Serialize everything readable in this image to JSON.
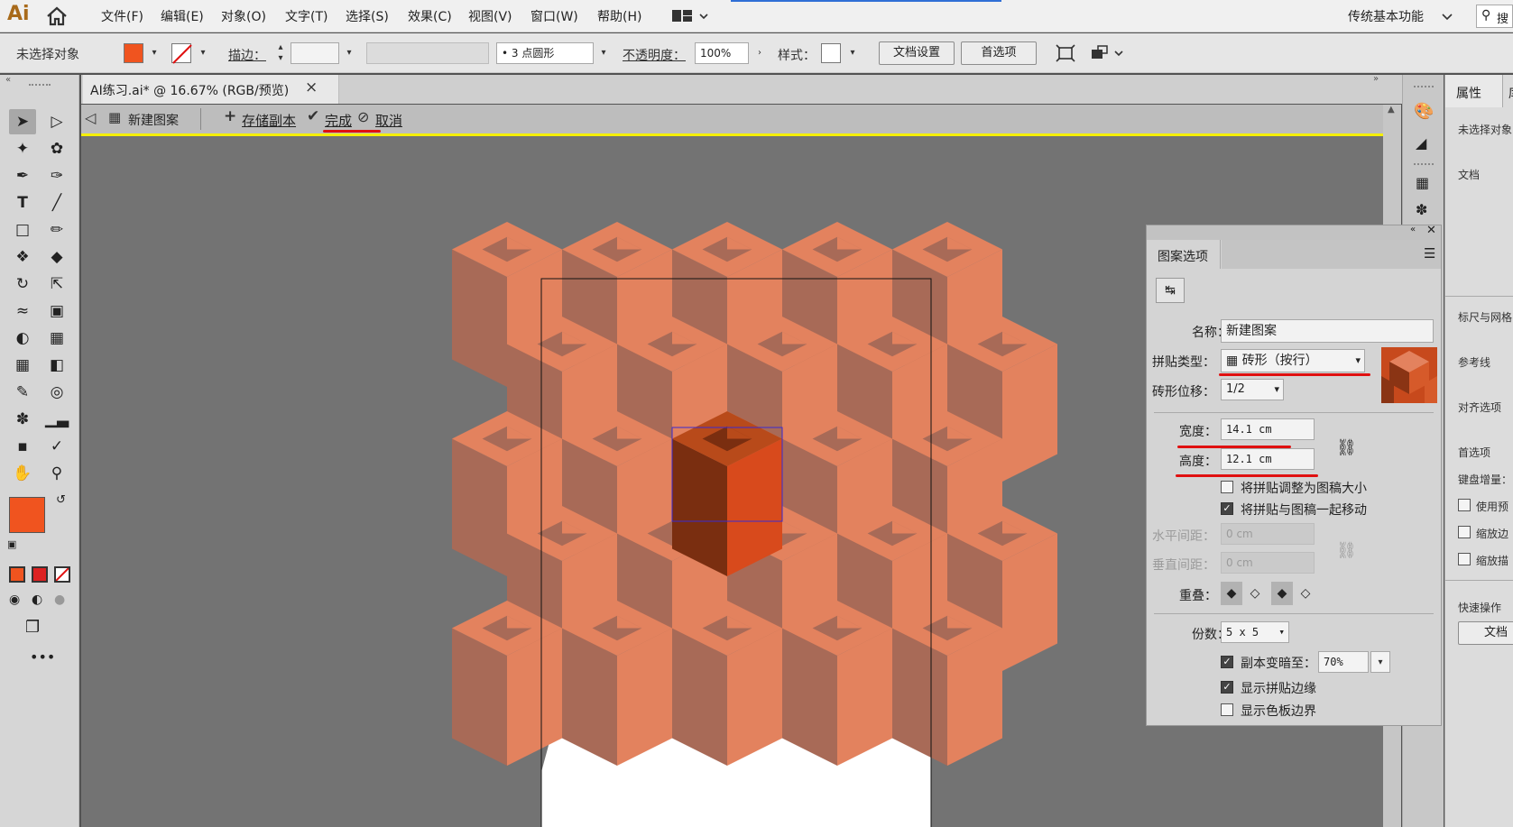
{
  "app": {
    "logo": "Ai"
  },
  "menu": [
    "文件(F)",
    "编辑(E)",
    "对象(O)",
    "文字(T)",
    "选择(S)",
    "效果(C)",
    "视图(V)",
    "窗口(W)",
    "帮助(H)"
  ],
  "workspace": {
    "label": "传统基本功能"
  },
  "search": {
    "label": "搜"
  },
  "control": {
    "selection": "未选择对象",
    "fill_color": "#f0541f",
    "stroke_label": "描边：",
    "stroke_weight_value": "",
    "brush": "3 点圆形",
    "opacity_label": "不透明度：",
    "opacity_value": "100%",
    "style_label": "样式：",
    "doc_settings": "文档设置",
    "prefs": "首选项"
  },
  "tab": {
    "title": "AI练习.ai* @ 16.67% (RGB/预览)",
    "close": "×"
  },
  "isolation": {
    "name": "新建图案",
    "save_copy": "存储副本",
    "done": "完成",
    "cancel": "取消"
  },
  "panel": {
    "title": "图案选项",
    "name_label": "名称：",
    "name_value": "新建图案",
    "tile_type_label": "拼贴类型：",
    "tile_type_value": "砖形（按行）",
    "brick_offset_label": "砖形位移：",
    "brick_offset_value": "1/2",
    "width_label": "宽度：",
    "width_value": "14.1 cm",
    "height_label": "高度：",
    "height_value": "12.1 cm",
    "size_tile_to_art": "将拼贴调整为图稿大小",
    "move_tile_with_art": "将拼贴与图稿一起移动",
    "h_spacing_label": "水平间距：",
    "h_spacing_value": "0 cm",
    "v_spacing_label": "垂直间距：",
    "v_spacing_value": "0 cm",
    "overlap_label": "重叠：",
    "copies_label": "份数：",
    "copies_value": "5 x 5",
    "dim_copies_label": "副本变暗至：",
    "dim_copies_value": "70%",
    "show_tile_edge": "显示拼贴边缘",
    "show_swatch_bounds": "显示色板边界"
  },
  "properties": {
    "tab": "属性",
    "tab2": "库",
    "no_selection": "未选择对象",
    "document": "文档",
    "rulers": "标尺与网格",
    "guides": "参考线",
    "snap": "对齐选项",
    "prefs": "首选项",
    "keyboard_increment": "键盘增量：",
    "use_preview": "使用预",
    "scale_corners": "缩放边",
    "scale_strokes": "缩放描",
    "quick_actions": "快速操作",
    "doc_button": "文档"
  },
  "colors": {
    "cube_top": "#e3825e",
    "cube_left": "#a86a57",
    "cube_right": "#e3825e",
    "center_top": "#b84a1a",
    "center_left": "#7a2e10",
    "center_right": "#d84a1c"
  }
}
